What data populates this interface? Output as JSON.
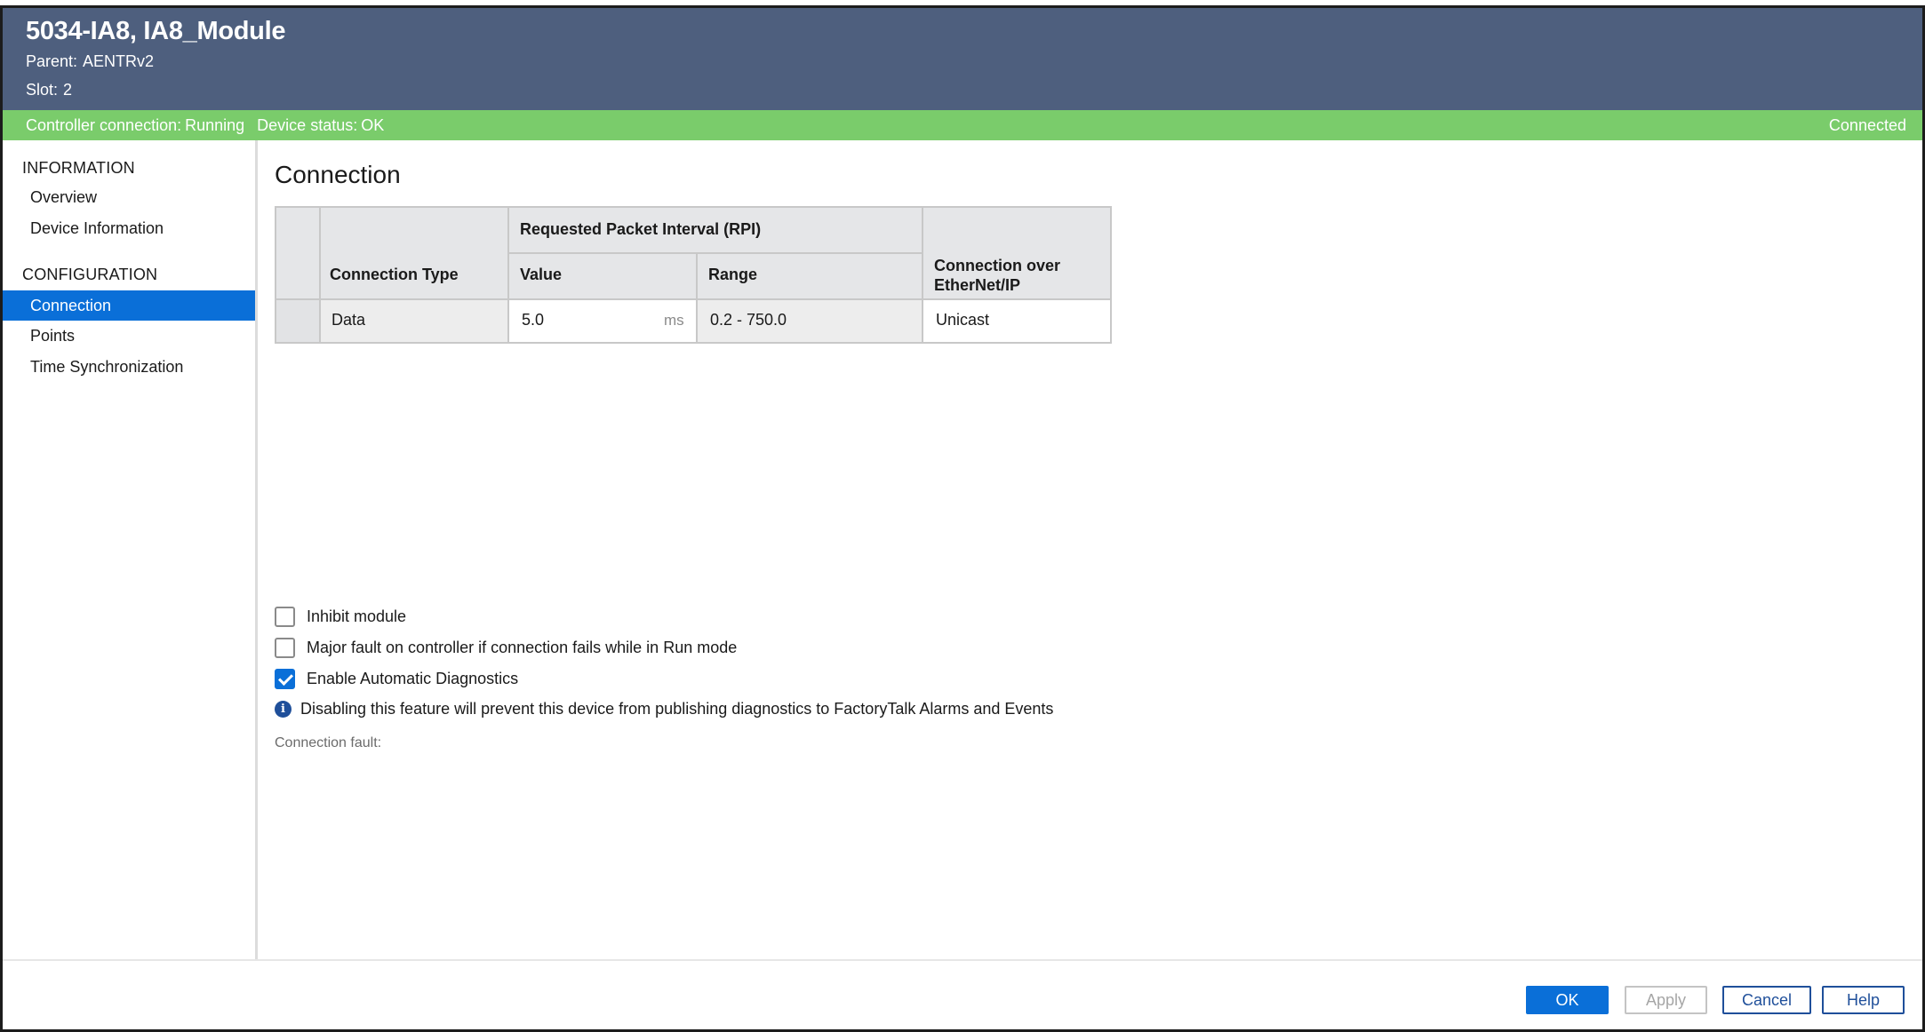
{
  "header": {
    "title": "5034-IA8, IA8_Module",
    "parent_label": "Parent:",
    "parent_value": "AENTRv2",
    "slot_label": "Slot:",
    "slot_value": "2"
  },
  "status_bar": {
    "controller_connection_label": "Controller connection:",
    "controller_connection_value": "Running",
    "device_status_label": "Device status:",
    "device_status_value": "OK",
    "connection_state": "Connected",
    "color": "#7acc6b"
  },
  "sidebar": {
    "sections": [
      {
        "heading": "INFORMATION",
        "items": [
          {
            "label": "Overview"
          },
          {
            "label": "Device Information"
          }
        ]
      },
      {
        "heading": "CONFIGURATION",
        "items": [
          {
            "label": "Connection",
            "active": true
          },
          {
            "label": "Points"
          },
          {
            "label": "Time Synchronization"
          }
        ]
      }
    ]
  },
  "content": {
    "title": "Connection",
    "table": {
      "rpi_header": "Requested Packet Interval (RPI)",
      "columns": {
        "connection_type": "Connection Type",
        "value": "Value",
        "range": "Range",
        "connection_over": "Connection over EtherNet/IP"
      },
      "rows": [
        {
          "connection_type": "Data",
          "value": "5.0",
          "value_unit": "ms",
          "range": "0.2 - 750.0",
          "connection_over": "Unicast"
        }
      ]
    },
    "options": [
      {
        "label": "Inhibit module",
        "checked": false
      },
      {
        "label": "Major fault on controller if connection fails while in Run mode",
        "checked": false
      },
      {
        "label": "Enable Automatic Diagnostics",
        "checked": true
      }
    ],
    "info_text": "Disabling this feature will prevent this device from publishing diagnostics to FactoryTalk Alarms and Events",
    "info_icon": "info-icon",
    "connection_fault_label": "Connection fault:"
  },
  "footer": {
    "ok_label": "OK",
    "apply_label": "Apply",
    "cancel_label": "Cancel",
    "help_label": "Help"
  },
  "colors": {
    "header_bg": "#4e5f7e",
    "accent": "#0a6fd8",
    "status_ok": "#7acc6b"
  }
}
